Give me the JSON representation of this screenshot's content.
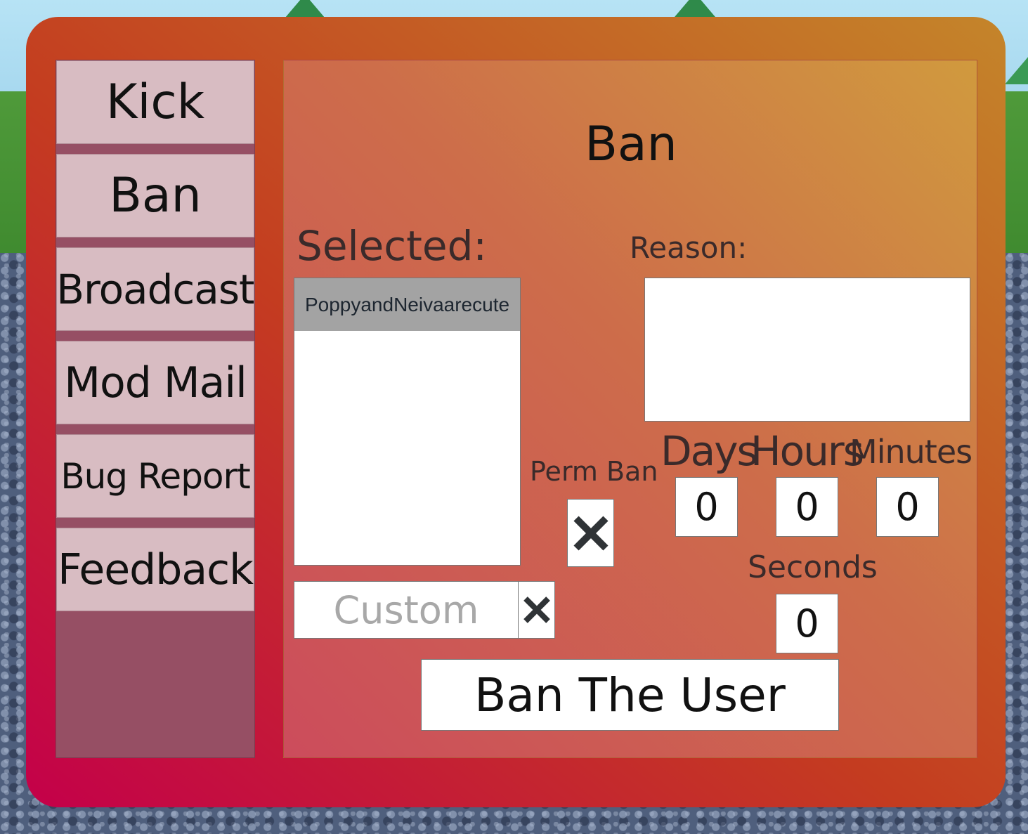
{
  "sidebar": {
    "items": [
      {
        "label": "Kick"
      },
      {
        "label": "Ban"
      },
      {
        "label": "Broadcast"
      },
      {
        "label": "Mod Mail"
      },
      {
        "label": "Bug Report"
      },
      {
        "label": "Feedback"
      }
    ]
  },
  "panel": {
    "title": "Ban",
    "selected_label": "Selected:",
    "reason_label": "Reason:",
    "reason_value": "",
    "players": [
      "PoppyandNeivaarecute"
    ],
    "custom": {
      "placeholder": "Custom",
      "value": ""
    },
    "perm_ban_label": "Perm Ban",
    "perm_ban_icon": "close-icon",
    "duration": {
      "days_label": "Days",
      "hours_label": "Hours",
      "minutes_label": "Minutes",
      "seconds_label": "Seconds",
      "days": "0",
      "hours": "0",
      "minutes": "0",
      "seconds": "0"
    },
    "submit_label": "Ban The User"
  },
  "colors": {
    "window_gradient": [
      "#c4004a",
      "#c4852a"
    ],
    "nav_button": "#d8bcc2",
    "selected_row": "#a3a3a3"
  }
}
